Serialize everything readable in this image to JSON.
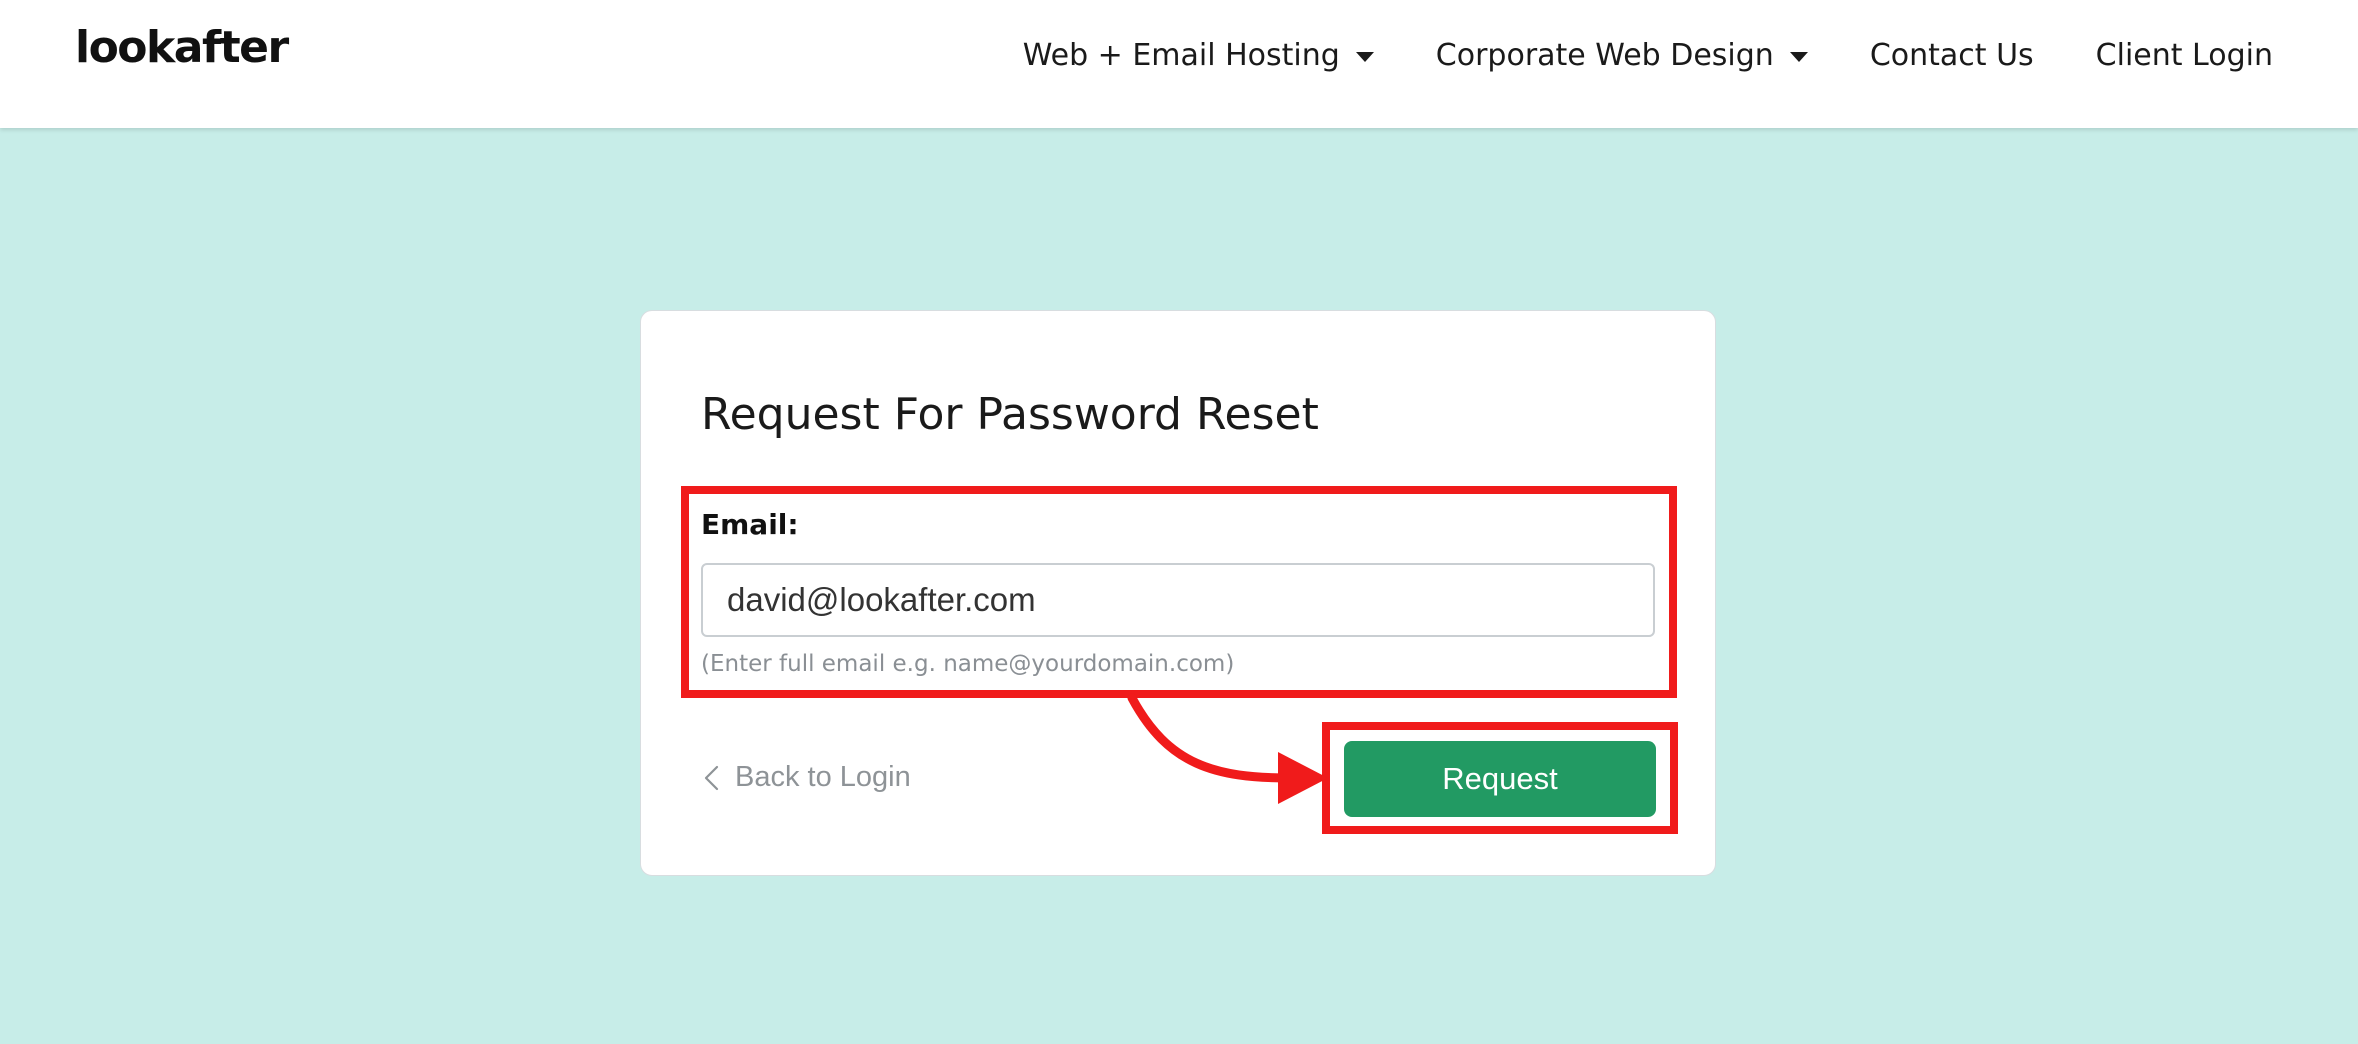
{
  "header": {
    "logo": "lookafter",
    "nav": [
      {
        "label": "Web + Email Hosting",
        "dropdown": true
      },
      {
        "label": "Corporate Web Design",
        "dropdown": true
      },
      {
        "label": "Contact Us",
        "dropdown": false
      },
      {
        "label": "Client Login",
        "dropdown": false
      }
    ]
  },
  "form": {
    "title": "Request For Password Reset",
    "email_label": "Email:",
    "email_value": "david@lookafter.com",
    "help_text": "(Enter full email e.g. name@yourdomain.com)",
    "back_link": "Back to Login",
    "submit_label": "Request"
  },
  "colors": {
    "page_background": "#c7ede8",
    "button": "#229a63",
    "annotation": "#f01b1b"
  }
}
